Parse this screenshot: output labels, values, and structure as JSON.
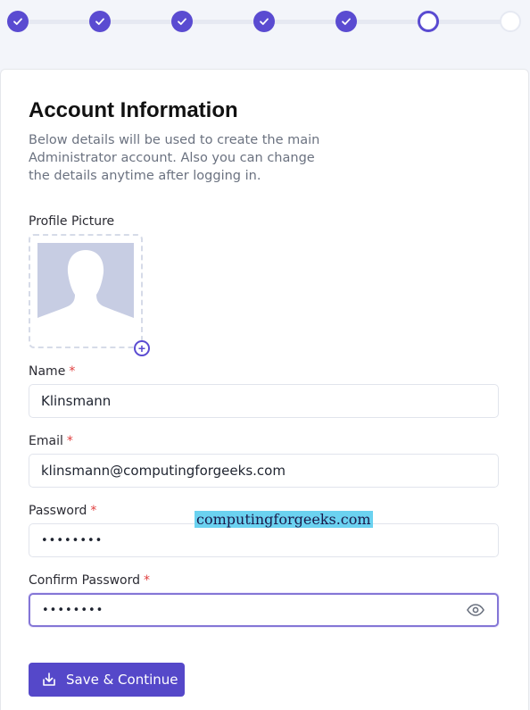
{
  "stepper": {
    "steps": [
      {
        "state": "done"
      },
      {
        "state": "done"
      },
      {
        "state": "done"
      },
      {
        "state": "done"
      },
      {
        "state": "done"
      },
      {
        "state": "current"
      },
      {
        "state": "todo"
      }
    ]
  },
  "form": {
    "title": "Account Information",
    "subtitle": "Below details will be used to create the main Administrator account. Also you can change the details anytime after logging in.",
    "profile_picture_label": "Profile Picture",
    "name_label": "Name",
    "name_value": "Klinsmann",
    "email_label": "Email",
    "email_value": "klinsmann@computingforgeeks.com",
    "password_label": "Password",
    "password_value": "••••••••",
    "confirm_password_label": "Confirm Password",
    "confirm_password_value": "••••••••",
    "required_mark": "*",
    "save_button": "Save & Continue"
  },
  "watermark": "computingforgeeks.com",
  "colors": {
    "accent": "#5a4bd1",
    "required": "#e03e3e",
    "avatar_bg": "#c7cde3"
  },
  "icons": {
    "step_done": "check-icon",
    "avatar_add": "plus-circle-icon",
    "password_toggle": "eye-icon",
    "save": "save-download-icon"
  }
}
